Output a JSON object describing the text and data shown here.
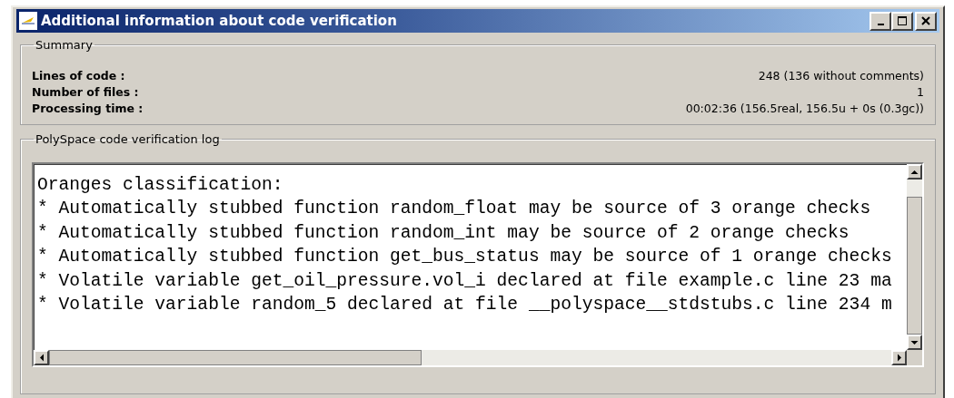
{
  "window": {
    "title": "Additional information about code verification"
  },
  "summary": {
    "legend": "Summary",
    "rows": [
      {
        "label": "Lines of code :",
        "value": "248 (136 without comments)"
      },
      {
        "label": "Number of files :",
        "value": "1"
      },
      {
        "label": "Processing time :",
        "value": "00:02:36 (156.5real, 156.5u + 0s (0.3gc))"
      }
    ]
  },
  "log": {
    "legend": "PolySpace code verification log",
    "lines": [
      "Oranges classification:",
      "* Automatically stubbed function random_float may be source of 3 orange checks",
      "* Automatically stubbed function random_int may be source of 2 orange checks",
      "* Automatically stubbed function get_bus_status may be source of 1 orange checks",
      "* Volatile variable get_oil_pressure.vol_i declared at file example.c line 23 ma",
      "* Volatile variable random_5 declared at file __polyspace__stdstubs.c line 234 m"
    ]
  }
}
